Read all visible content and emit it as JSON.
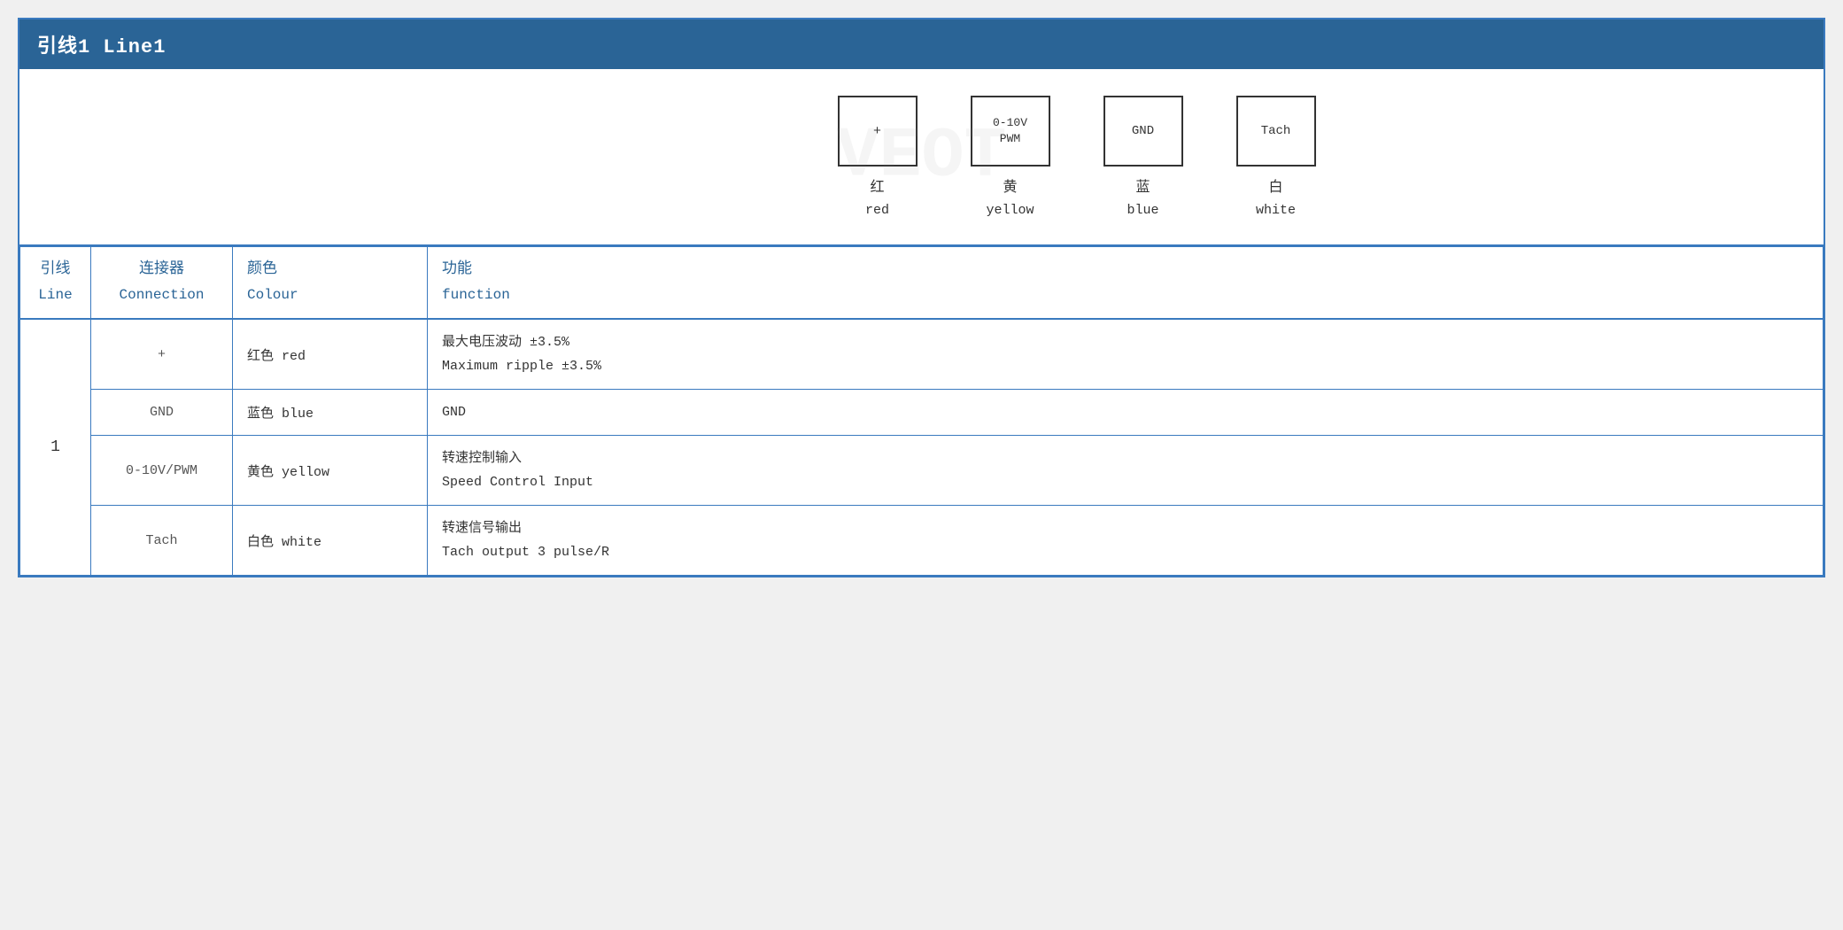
{
  "title": "引线1 Line1",
  "diagram": {
    "connectors": [
      {
        "label": "+",
        "chinese": "红",
        "english": "red"
      },
      {
        "label": "0-10V\nPWM",
        "chinese": "黄",
        "english": "yellow"
      },
      {
        "label": "GND",
        "chinese": "蓝",
        "english": "blue"
      },
      {
        "label": "Tach",
        "chinese": "白",
        "english": "white"
      }
    ]
  },
  "table": {
    "headers": {
      "line_chinese": "引线",
      "line_english": "Line",
      "connection_chinese": "连接器",
      "connection_english": "Connection",
      "colour_chinese": "颜色",
      "colour_english": "Colour",
      "function_chinese": "功能",
      "function_english": "function"
    },
    "rows": [
      {
        "line": "1",
        "connection": "+",
        "colour_chinese": "红色",
        "colour_english": "red",
        "function_chinese": "最大电压波动 ±3.5%",
        "function_english": "Maximum ripple ±3.5%"
      },
      {
        "line": "",
        "connection": "GND",
        "colour_chinese": "蓝色",
        "colour_english": "blue",
        "function_chinese": "GND",
        "function_english": ""
      },
      {
        "line": "",
        "connection": "0-10V/PWM",
        "colour_chinese": "黄色",
        "colour_english": "yellow",
        "function_chinese": "转速控制输入",
        "function_english": "Speed Control Input"
      },
      {
        "line": "",
        "connection": "Tach",
        "colour_chinese": "白色",
        "colour_english": "white",
        "function_chinese": "转速信号输出",
        "function_english": "Tach output 3 pulse/R"
      }
    ]
  }
}
